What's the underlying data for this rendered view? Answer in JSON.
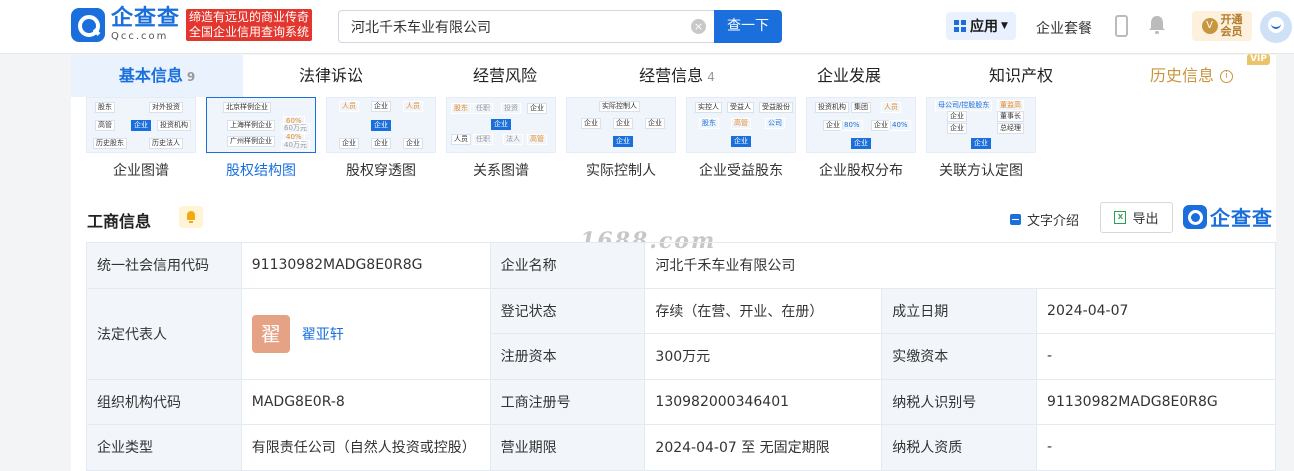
{
  "header": {
    "logo_cn": "企查查",
    "logo_en": "Qcc.com",
    "slogan_line1": "缔造有远见的商业传奇",
    "slogan_line2": "全国企业信用查询系统",
    "search_value": "河北千禾车业有限公司",
    "search_button": "查一下",
    "apps_label": "应用",
    "suite_label": "企业套餐",
    "vip_line1": "开通",
    "vip_line2": "会员"
  },
  "tabs": [
    {
      "label": "基本信息",
      "count": "9"
    },
    {
      "label": "法律诉讼",
      "count": ""
    },
    {
      "label": "经营风险",
      "count": ""
    },
    {
      "label": "经营信息",
      "count": "4"
    },
    {
      "label": "企业发展",
      "count": ""
    },
    {
      "label": "知识产权",
      "count": ""
    },
    {
      "label": "历史信息",
      "count": "",
      "tag": "VIP"
    }
  ],
  "graph_thumbs": [
    {
      "label": "企业图谱"
    },
    {
      "label": "股权结构图"
    },
    {
      "label": "股权穿透图"
    },
    {
      "label": "关系图谱"
    },
    {
      "label": "实际控制人"
    },
    {
      "label": "企业受益股东"
    },
    {
      "label": "企业股权分布"
    },
    {
      "label": "关联方认定图"
    }
  ],
  "thumb_text": {
    "t1": [
      "股东",
      "对外投资",
      "高管",
      "企业",
      "投资机构",
      "历史股东",
      "历史法人"
    ],
    "t2": [
      "北京样例企业",
      "上海样例企业",
      "广州样例企业",
      "60%",
      "40%",
      "60万元",
      "40万元"
    ],
    "t3": [
      "人员",
      "企业",
      "人员",
      "企业",
      "企业",
      "企业",
      "企业"
    ],
    "t4": [
      "股东",
      "任职",
      "投资",
      "企业",
      "企业",
      "人员",
      "高管",
      "任职",
      "法人",
      "企业"
    ],
    "t5": [
      "实际控制人",
      "企业",
      "企业",
      "企业",
      "企业"
    ],
    "t6": [
      "实控人",
      "受益人",
      "受益股份",
      "股东",
      "高管",
      "公司",
      "企业"
    ],
    "t7": [
      "投资机构",
      "集团",
      "人员",
      "企业",
      "80%",
      "企业",
      "40%",
      "企业"
    ],
    "t8": [
      "母公司/控股股东",
      "董监高",
      "企业",
      "董事长",
      "企业",
      "总经理",
      "企业"
    ]
  },
  "section": {
    "title": "工商信息",
    "text_intro": "文字介绍",
    "export": "导出",
    "brand": "企查查"
  },
  "watermark": "1688.com",
  "info": {
    "credit_code_label": "统一社会信用代码",
    "credit_code": "91130982MADG8E0R8G",
    "company_name_label": "企业名称",
    "company_name": "河北千禾车业有限公司",
    "legal_rep_label": "法定代表人",
    "legal_rep_avatar": "翟",
    "legal_rep": "翟亚轩",
    "reg_status_label": "登记状态",
    "reg_status": "存续（在营、开业、在册）",
    "founded_label": "成立日期",
    "founded": "2024-04-07",
    "reg_capital_label": "注册资本",
    "reg_capital": "300万元",
    "paid_capital_label": "实缴资本",
    "paid_capital": "-",
    "org_code_label": "组织机构代码",
    "org_code": "MADG8E0R-8",
    "biz_reg_no_label": "工商注册号",
    "biz_reg_no": "130982000346401",
    "taxpayer_id_label": "纳税人识别号",
    "taxpayer_id": "91130982MADG8E0R8G",
    "company_type_label": "企业类型",
    "company_type": "有限责任公司（自然人投资或控股）",
    "biz_term_label": "营业期限",
    "biz_term": "2024-04-07 至 无固定期限",
    "taxpayer_qual_label": "纳税人资质",
    "taxpayer_qual": "-"
  }
}
